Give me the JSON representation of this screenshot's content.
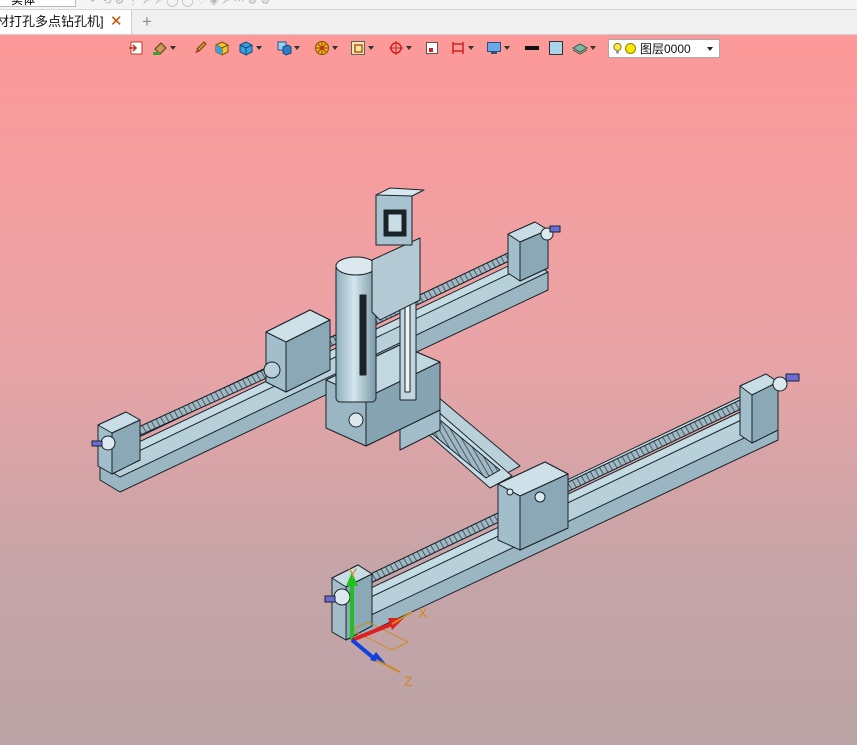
{
  "top_strip": {
    "combo_text": "实体"
  },
  "tab": {
    "title": "材打孔多点钻孔机]",
    "close_glyph": "✕",
    "new_glyph": "+"
  },
  "toolbar": {
    "layer": {
      "name": "图层0000"
    }
  },
  "icons": [
    "window-icon",
    "paint-bucket-icon",
    "brush-icon",
    "solid-box-icon",
    "cube-icon",
    "display-cube-icon",
    "wheel-icon",
    "frame-icon",
    "view-axes-icon",
    "rectangle-icon",
    "fence-icon",
    "monitor-icon",
    "line-color-icon",
    "fill-color-icon",
    "layer-stack-icon",
    "bulb-icon",
    "sun-icon"
  ],
  "colors": {
    "viewport_top": "#fd9999",
    "viewport_bottom": "#bba4a7",
    "model_body": "#a7c3cf",
    "model_edge": "#1a2328",
    "axis_x": "#e02020",
    "axis_y": "#20c020",
    "axis_z": "#1040e0",
    "axis_label": "#d08a20"
  },
  "axes": {
    "x": "X",
    "y": "Y",
    "z": "Z"
  }
}
